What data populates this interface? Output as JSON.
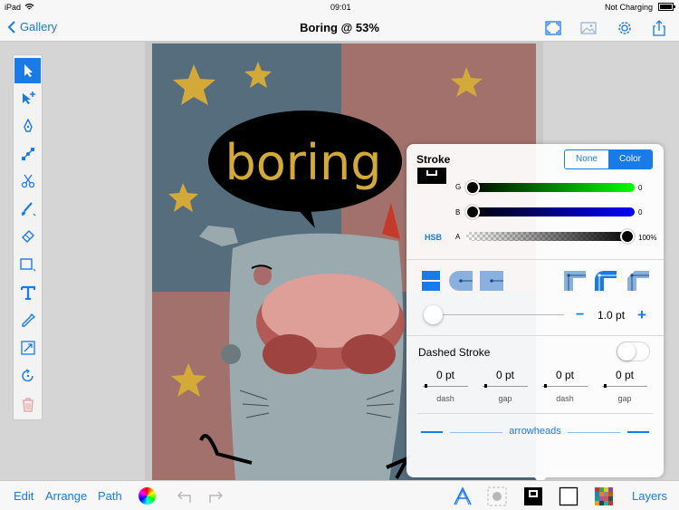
{
  "status_bar": {
    "device": "iPad",
    "time": "09:01",
    "battery": "Not Charging"
  },
  "nav": {
    "back_label": "Gallery",
    "title": "Boring @ 53%",
    "icons": [
      "fullscreen-icon",
      "image-icon",
      "gear-icon",
      "share-icon"
    ]
  },
  "artwork": {
    "speech_text": "boring"
  },
  "toolbox": {
    "tools": [
      "select-arrow-icon",
      "subselect-arrow-icon",
      "pen-icon",
      "add-node-icon",
      "scissors-icon",
      "brush-icon",
      "eraser-icon",
      "rectangle-icon",
      "text-tool-icon",
      "eyedropper-icon",
      "scale-icon",
      "rotate-icon",
      "trash-icon"
    ],
    "active_index": 0
  },
  "stroke_panel": {
    "title": "Stroke",
    "mode_options": [
      "None",
      "Color"
    ],
    "mode_selected": "Color",
    "color_mode_button": "HSB",
    "sliders": [
      {
        "label": "G",
        "value": "0"
      },
      {
        "label": "B",
        "value": "0"
      },
      {
        "label": "A",
        "value": "100%"
      }
    ],
    "width_value": "1.0 pt",
    "minus_label": "−",
    "plus_label": "+",
    "dashed_label": "Dashed Stroke",
    "dashed_on": false,
    "dash_fields": [
      {
        "value": "0 pt",
        "label": "dash"
      },
      {
        "value": "0 pt",
        "label": "gap"
      },
      {
        "value": "0 pt",
        "label": "dash"
      },
      {
        "value": "0 pt",
        "label": "gap"
      }
    ],
    "arrowheads_label": "arrowheads"
  },
  "bottom_bar": {
    "edit": "Edit",
    "arrange": "Arrange",
    "path": "Path",
    "layers": "Layers"
  },
  "colors": {
    "accent": "#1a7ae8",
    "art_blue": "#566d7d",
    "art_pink": "#a3716b",
    "star": "#d3a93a"
  }
}
